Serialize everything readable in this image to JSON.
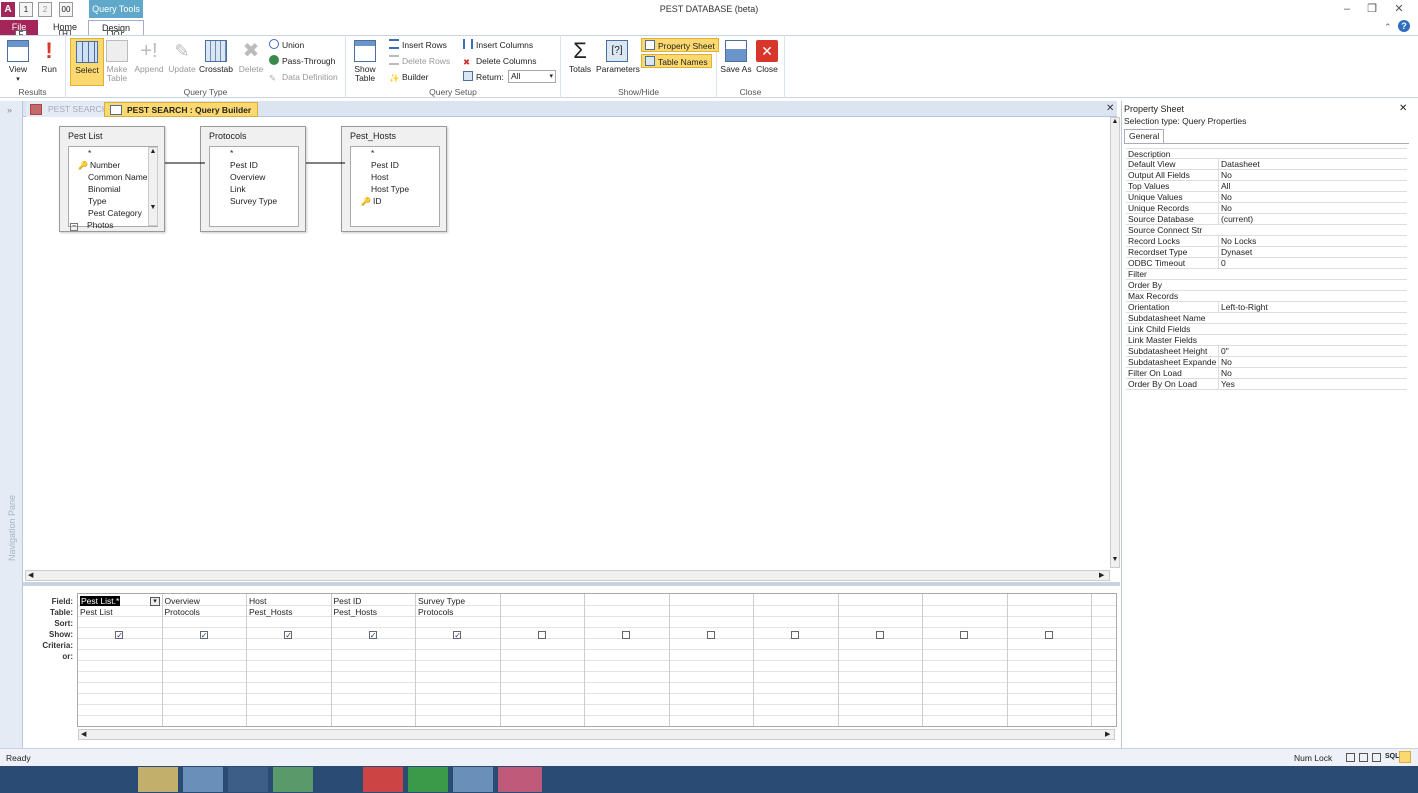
{
  "window": {
    "title": "PEST DATABASE (beta)",
    "context_tab": "Query Tools",
    "qat_tips": [
      "1",
      "2",
      "00"
    ]
  },
  "ribbon": {
    "tabs": {
      "file": "File",
      "home": "Home",
      "design": "Design"
    },
    "keytips": {
      "file": "F",
      "home": "H",
      "design": "JQ"
    },
    "results": {
      "label": "Results",
      "view": "View",
      "run": "Run"
    },
    "query_type": {
      "label": "Query Type",
      "select": "Select",
      "make_table": "Make Table",
      "append": "Append",
      "update": "Update",
      "crosstab": "Crosstab",
      "delete": "Delete",
      "union": "Union",
      "pass_through": "Pass-Through",
      "data_definition": "Data Definition"
    },
    "query_setup": {
      "label": "Query Setup",
      "show_table": "Show Table",
      "insert_rows": "Insert Rows",
      "delete_rows": "Delete Rows",
      "builder": "Builder",
      "insert_columns": "Insert Columns",
      "delete_columns": "Delete Columns",
      "return_label": "Return:",
      "return_value": "All"
    },
    "show_hide": {
      "label": "Show/Hide",
      "totals": "Totals",
      "parameters": "Parameters",
      "property_sheet": "Property Sheet",
      "table_names": "Table Names"
    },
    "close": {
      "label": "Close",
      "save_as": "Save As",
      "close": "Close"
    }
  },
  "doc_tabs": {
    "tab1": "PEST SEARCH",
    "tab2": "PEST SEARCH : Query Builder"
  },
  "nav_pane": {
    "label": "Navigation Pane"
  },
  "tables": [
    {
      "name": "Pest List",
      "fields": [
        "*",
        "Number",
        "Common Name",
        "Binomial",
        "Type",
        "Pest Category",
        "Photos"
      ]
    },
    {
      "name": "Protocols",
      "fields": [
        "*",
        "Pest ID",
        "Overview",
        "Link",
        "Survey Type"
      ]
    },
    {
      "name": "Pest_Hosts",
      "fields": [
        "*",
        "Pest ID",
        "Host",
        "Host Type",
        "ID"
      ]
    }
  ],
  "grid": {
    "row_labels": {
      "field": "Field:",
      "table": "Table:",
      "sort": "Sort:",
      "show": "Show:",
      "criteria": "Criteria:",
      "or": "or:"
    },
    "columns": [
      {
        "field": "Pest List.*",
        "table": "Pest List",
        "show": true
      },
      {
        "field": "Overview",
        "table": "Protocols",
        "show": true
      },
      {
        "field": "Host",
        "table": "Pest_Hosts",
        "show": true
      },
      {
        "field": "Pest ID",
        "table": "Pest_Hosts",
        "show": true
      },
      {
        "field": "Survey Type",
        "table": "Protocols",
        "show": true
      },
      {
        "field": "",
        "table": "",
        "show": false
      },
      {
        "field": "",
        "table": "",
        "show": false
      },
      {
        "field": "",
        "table": "",
        "show": false
      },
      {
        "field": "",
        "table": "",
        "show": false
      },
      {
        "field": "",
        "table": "",
        "show": false
      },
      {
        "field": "",
        "table": "",
        "show": false
      },
      {
        "field": "",
        "table": "",
        "show": false
      }
    ]
  },
  "property_sheet": {
    "title": "Property Sheet",
    "selection_type": "Selection type:  Query Properties",
    "tab": "General",
    "rows": [
      {
        "name": "Description",
        "value": ""
      },
      {
        "name": "Default View",
        "value": "Datasheet"
      },
      {
        "name": "Output All Fields",
        "value": "No"
      },
      {
        "name": "Top Values",
        "value": "All"
      },
      {
        "name": "Unique Values",
        "value": "No"
      },
      {
        "name": "Unique Records",
        "value": "No"
      },
      {
        "name": "Source Database",
        "value": "(current)"
      },
      {
        "name": "Source Connect Str",
        "value": ""
      },
      {
        "name": "Record Locks",
        "value": "No Locks"
      },
      {
        "name": "Recordset Type",
        "value": "Dynaset"
      },
      {
        "name": "ODBC Timeout",
        "value": "0"
      },
      {
        "name": "Filter",
        "value": ""
      },
      {
        "name": "Order By",
        "value": ""
      },
      {
        "name": "Max Records",
        "value": ""
      },
      {
        "name": "Orientation",
        "value": "Left-to-Right"
      },
      {
        "name": "Subdatasheet Name",
        "value": ""
      },
      {
        "name": "Link Child Fields",
        "value": ""
      },
      {
        "name": "Link Master Fields",
        "value": ""
      },
      {
        "name": "Subdatasheet Height",
        "value": "0\""
      },
      {
        "name": "Subdatasheet Expanded",
        "value": "No"
      },
      {
        "name": "Filter On Load",
        "value": "No"
      },
      {
        "name": "Order By On Load",
        "value": "Yes"
      }
    ]
  },
  "status": {
    "left": "Ready",
    "num_lock": "Num Lock"
  },
  "colors": {
    "file_tab": "#a4255a",
    "context_tab": "#5fa8c9",
    "highlight": "#fcd970"
  }
}
